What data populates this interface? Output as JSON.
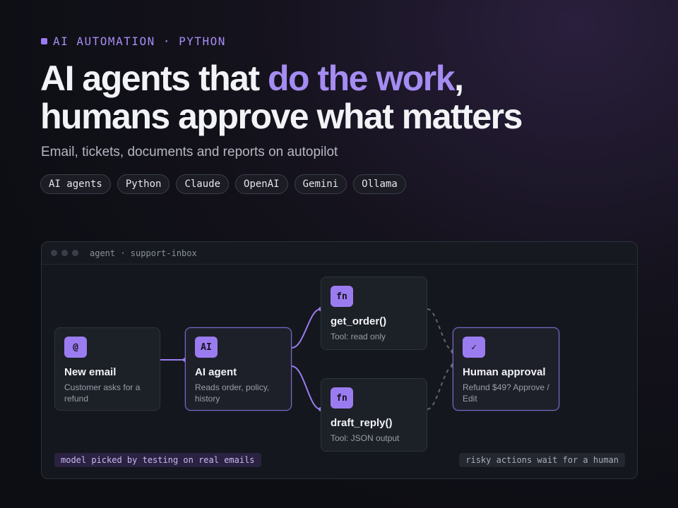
{
  "hero": {
    "eyebrow": "AI AUTOMATION · PYTHON",
    "headline_part1": "AI agents that ",
    "headline_accent": "do the work",
    "headline_part2": ",",
    "headline_line2": "humans approve what matters",
    "subtitle": "Email, tickets, documents and reports on autopilot",
    "tags": [
      "AI agents",
      "Python",
      "Claude",
      "OpenAI",
      "Gemini",
      "Ollama"
    ]
  },
  "window": {
    "title": "agent · support-inbox",
    "nodes": [
      {
        "badge": "@",
        "title": "New email",
        "desc": "Customer asks for a refund"
      },
      {
        "badge": "AI",
        "title": "AI agent",
        "desc": "Reads order, policy, history"
      },
      {
        "badge": "fn",
        "title": "get_order()",
        "desc": "Tool: read only"
      },
      {
        "badge": "fn",
        "title": "draft_reply()",
        "desc": "Tool: JSON output"
      },
      {
        "badge": "✓",
        "title": "Human approval",
        "desc": "Refund $49? Approve / Edit"
      }
    ],
    "note_left": "model picked by testing on real emails",
    "note_right": "risky actions wait for a human"
  },
  "colors": {
    "accent": "#a58cf2",
    "badge": "#9b7cf0",
    "background": "#0d0e14"
  }
}
